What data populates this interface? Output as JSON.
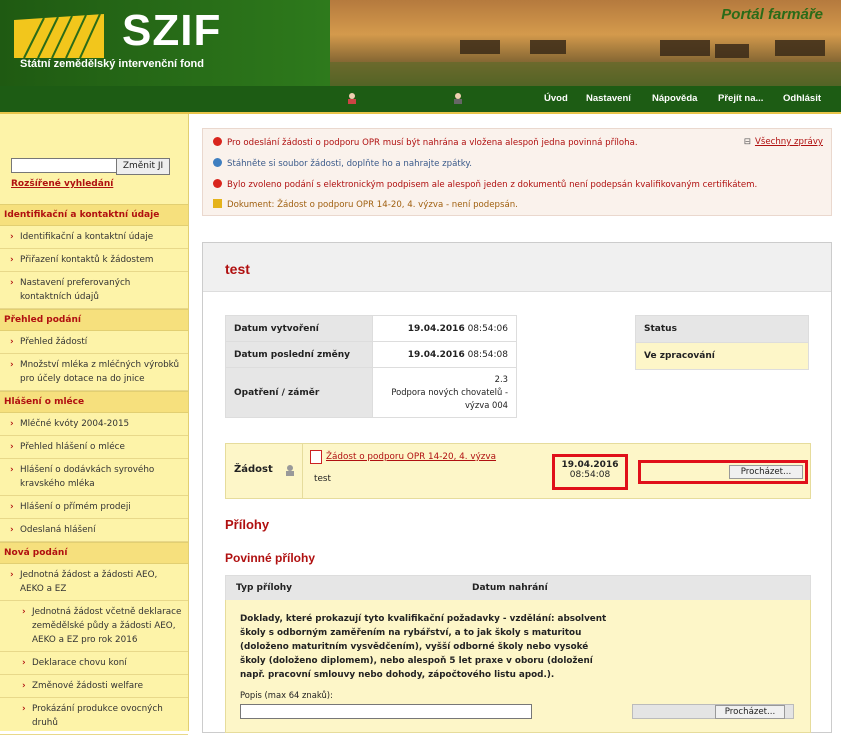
{
  "header": {
    "logo_text": "SZIF",
    "subtitle": "Státní zemědělský intervenční fond",
    "portal_title": "Portál farmáře"
  },
  "topnav": {
    "items": [
      "Úvod",
      "Nastavení",
      "Nápověda",
      "Přejít na...",
      "Odhlásit"
    ]
  },
  "sidebar": {
    "search_placeholder": "",
    "search_button": "Změnit JI",
    "advanced_search": "Rozšířené vyhledání",
    "sections": [
      {
        "title": "Identifikační a kontaktní údaje",
        "items": [
          "Identifikační a kontaktní údaje",
          "Přiřazení kontaktů k žádostem",
          "Nastavení preferovaných kontaktních údajů"
        ]
      },
      {
        "title": "Přehled podání",
        "items": [
          "Přehled žádostí",
          "Množství mléka z mléčných výrobků pro účely dotace na do jnice"
        ]
      },
      {
        "title": "Hlášení o mléce",
        "items": [
          "Mléčné kvóty 2004-2015",
          "Přehled hlášení o mléce",
          "Hlášení o dodávkách syrového kravského mléka",
          "Hlášení o přímém prodeji",
          "Odeslaná hlášení"
        ]
      },
      {
        "title": "Nová podání",
        "items": [
          "Jednotná žádost a žádosti AEO, AEKO a EZ"
        ],
        "subitems": [
          "Jednotná žádost včetně deklarace zemědělské půdy a žádosti AEO, AEKO a EZ pro rok 2016",
          "Deklarace chovu koní",
          "Změnové žádosti welfare",
          "Prokázání produkce ovocných druhů"
        ]
      }
    ]
  },
  "messages": {
    "items": [
      {
        "type": "error",
        "text": "Pro odeslání žádosti o podporu OPR musí být nahrána a vložena alespoň jedna povinná příloha."
      },
      {
        "type": "info",
        "text": "Stáhněte si soubor žádosti, doplňte ho a nahrajte zpátky."
      },
      {
        "type": "error",
        "text": "Bylo zvoleno podání s elektronickým podpisem ale alespoň jeden z dokumentů není podepsán kvalifikovaným certifikátem."
      },
      {
        "type": "warning",
        "text": "Dokument: Žádost o podporu OPR 14-20, 4. výzva - není podepsán."
      }
    ],
    "all_messages": "Všechny zprávy",
    "colors": {
      "error": "#d9251d",
      "info": "#3f7fc0",
      "warning": "#e5b31b"
    }
  },
  "main": {
    "title": "test",
    "info": [
      {
        "label": "Datum vytvoření",
        "date": "19.04.2016",
        "time": "08:54:06"
      },
      {
        "label": "Datum poslední změny",
        "date": "19.04.2016",
        "time": "08:54:08"
      },
      {
        "label": "Opatření / záměr",
        "line1": "2.3",
        "line2": "Podpora nových chovatelů -",
        "line3": "výzva 004"
      }
    ],
    "status_header": "Status",
    "status_value": "Ve zpracování",
    "request": {
      "label": "Žádost",
      "link": "Žádost o podporu OPR 14-20, 4. výzva",
      "note": "test",
      "date": "19.04.2016",
      "time": "08:54:08",
      "browse": "Procházet..."
    },
    "attachments_heading": "Přílohy",
    "mandatory_heading": "Povinné přílohy",
    "table_headers": [
      "Typ přílohy",
      "Datum nahrání"
    ],
    "attachment_desc": "Doklady, které prokazují tyto kvalifikační požadavky - vzdělání: absolvent školy s odborným zaměřením na rybářství, a to jak školy s maturitou (doloženo maturitním vysvědčením), vyšší odborné školy nebo vysoké školy (doloženo diplomem), nebo alespoň 5 let praxe v oboru (doložení např. pracovní smlouvy nebo dohody, zápočtového listu apod.).",
    "popis_label": "Popis (max 64 znaků):",
    "browse": "Procházet..."
  }
}
